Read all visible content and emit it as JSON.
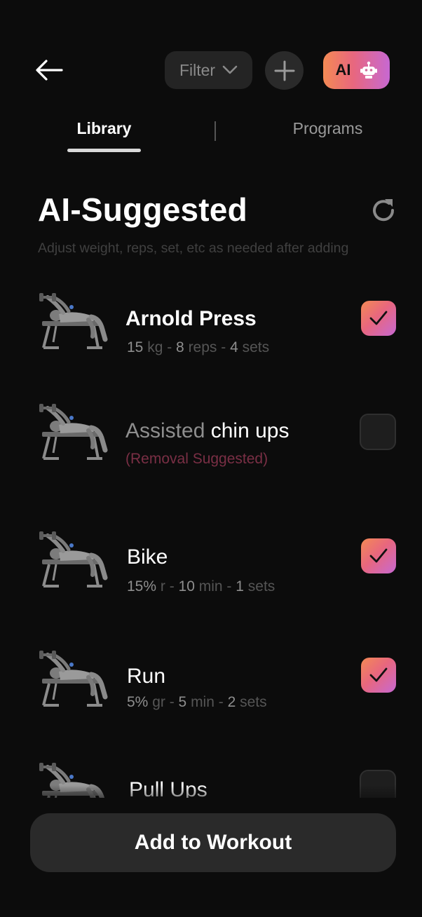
{
  "header": {
    "back_icon": "arrow-left-icon",
    "filter_label": "Filter",
    "add_icon": "plus-icon",
    "ai_label": "AI",
    "ai_icon": "robot-icon"
  },
  "tabs": [
    {
      "label": "Library",
      "active": true
    },
    {
      "label": "Programs",
      "active": false
    }
  ],
  "section": {
    "title": "AI-Suggested",
    "subtitle": "Adjust weight, reps, set, etc as needed after adding",
    "refresh_icon": "refresh-icon"
  },
  "exercises": [
    {
      "name": "Arnold Press",
      "meta": {
        "v1": "15",
        "u1": " kg",
        "sep1": " - ",
        "v2": "8",
        "u2": " reps",
        "sep2": " - ",
        "v3": "4",
        "u3": " sets"
      },
      "checked": true
    },
    {
      "name_prefix": "Assisted ",
      "name": "chin ups",
      "note": "(Removal Suggested)",
      "checked": false
    },
    {
      "name": "Bike",
      "meta": {
        "v1": "15%",
        "u1": " r",
        "sep1": " - ",
        "v2": "10",
        "u2": " min",
        "sep2": " - ",
        "v3": "1",
        "u3": " sets"
      },
      "checked": true
    },
    {
      "name": "Run",
      "meta": {
        "v1": "5%",
        "u1": " gr",
        "sep1": " - ",
        "v2": "5",
        "u2": " min",
        "sep2": " - ",
        "v3": "2",
        "u3": " sets"
      },
      "checked": true
    },
    {
      "name": "Pull Ups",
      "checked": false
    }
  ],
  "footer": {
    "add_label": "Add to Workout"
  },
  "colors": {
    "background": "#0c0c0c",
    "accent_gradient_start": "#f48a54",
    "accent_gradient_end": "#c768d2",
    "removal_text": "#7a2f45"
  }
}
